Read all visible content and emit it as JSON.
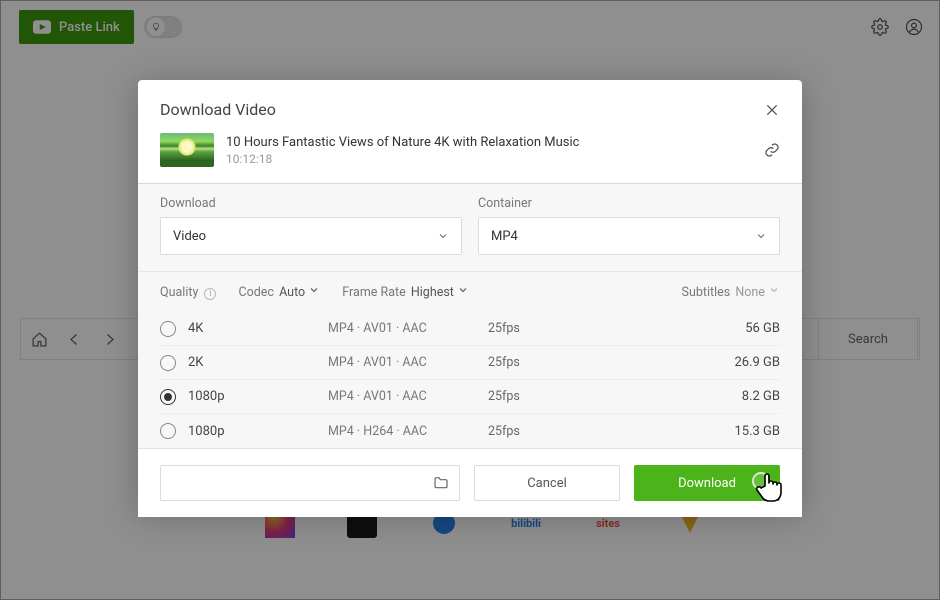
{
  "topbar": {
    "paste_label": "Paste Link"
  },
  "nav": {
    "search_label": "Search"
  },
  "modal": {
    "title": "Download Video",
    "video": {
      "name": "10 Hours Fantastic Views of Nature 4K with Relaxation Music",
      "duration": "10:12:18"
    },
    "download_label": "Download",
    "download_value": "Video",
    "container_label": "Container",
    "container_value": "MP4",
    "quality_label": "Quality",
    "codec_label": "Codec",
    "codec_value": "Auto",
    "framerate_label": "Frame Rate",
    "framerate_value": "Highest",
    "subtitles_label": "Subtitles",
    "subtitles_value": "None",
    "options": [
      {
        "quality": "4K",
        "codec": "MP4 · AV01 · AAC",
        "fps": "25fps",
        "size": "56 GB",
        "selected": false
      },
      {
        "quality": "2K",
        "codec": "MP4 · AV01 · AAC",
        "fps": "25fps",
        "size": "26.9 GB",
        "selected": false
      },
      {
        "quality": "1080p",
        "codec": "MP4 · AV01 · AAC",
        "fps": "25fps",
        "size": "8.2 GB",
        "selected": true
      },
      {
        "quality": "1080p",
        "codec": "MP4 · H264 · AAC",
        "fps": "25fps",
        "size": "15.3 GB",
        "selected": false
      }
    ],
    "cancel_label": "Cancel",
    "download_btn_label": "Download"
  },
  "colors": {
    "accent": "#4db31b"
  }
}
